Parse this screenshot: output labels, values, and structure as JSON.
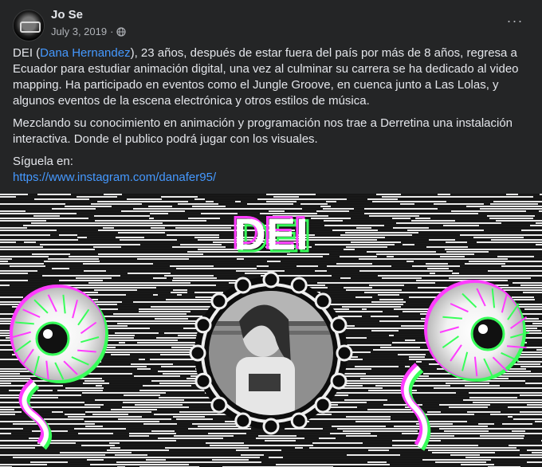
{
  "post": {
    "author": "Jo Se",
    "date": "July 3, 2019",
    "separator": "·",
    "privacy_icon": "globe-icon",
    "more_icon": "more-options-icon",
    "more_label": "···",
    "paragraph1": {
      "prefix": "DEI (",
      "mention": "Dana Hernandez",
      "suffix": "), 23 años, después de estar fuera del país por más de 8 años, regresa a Ecuador para estudiar animación digital, una vez al culminar su carrera se ha dedicado al video mapping. Ha participado en eventos como el Jungle Groove, en cuenca junto a Las Lolas, y algunos eventos de la escena electrónica y otros estilos de música."
    },
    "paragraph2": "Mezclando su conocimiento en animación y programación nos trae a Derretina  una  instalación interactiva. Donde el publico podrá jugar con los visuales.",
    "paragraph3_label": "Síguela en:",
    "paragraph3_link": "https://www.instagram.com/danafer95/"
  },
  "media": {
    "title_text": "DEI",
    "colors": {
      "background": "#242526",
      "link": "#4599ff",
      "glitch_green": "#38ff5a",
      "glitch_magenta": "#ff3cff"
    }
  }
}
